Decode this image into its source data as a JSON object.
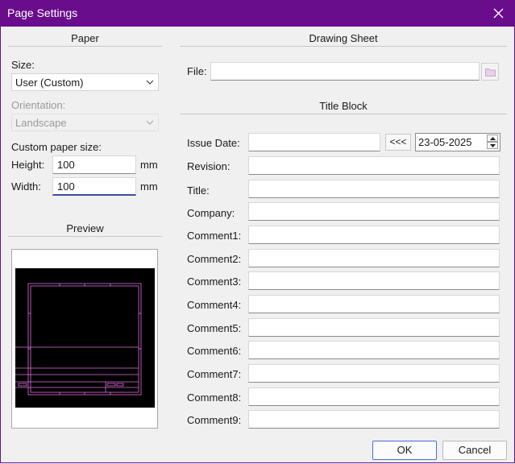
{
  "window": {
    "title": "Page Settings"
  },
  "paper": {
    "section_title": "Paper",
    "size_label": "Size:",
    "size_value": "User (Custom)",
    "orientation_label": "Orientation:",
    "orientation_value": "Landscape",
    "custom_size_label": "Custom paper size:",
    "height_label": "Height:",
    "height_value": "100",
    "height_unit": "mm",
    "width_label": "Width:",
    "width_value": "100",
    "width_unit": "mm"
  },
  "preview": {
    "section_title": "Preview"
  },
  "drawing_sheet": {
    "section_title": "Drawing Sheet",
    "file_label": "File:",
    "file_value": ""
  },
  "title_block": {
    "section_title": "Title Block",
    "issue_date_label": "Issue Date:",
    "issue_date_value": "",
    "copy_date_button": "<<<",
    "date_value": "23-05-2025",
    "fields": [
      {
        "label": "Revision:",
        "value": ""
      },
      {
        "label": "Title:",
        "value": ""
      },
      {
        "label": "Company:",
        "value": ""
      },
      {
        "label": "Comment1:",
        "value": ""
      },
      {
        "label": "Comment2:",
        "value": ""
      },
      {
        "label": "Comment3:",
        "value": ""
      },
      {
        "label": "Comment4:",
        "value": ""
      },
      {
        "label": "Comment5:",
        "value": ""
      },
      {
        "label": "Comment6:",
        "value": ""
      },
      {
        "label": "Comment7:",
        "value": ""
      },
      {
        "label": "Comment8:",
        "value": ""
      },
      {
        "label": "Comment9:",
        "value": ""
      }
    ]
  },
  "buttons": {
    "ok": "OK",
    "cancel": "Cancel"
  },
  "colors": {
    "titlebar": "#6a0d8d",
    "preview_lines": "#e070e0",
    "focus": "#3a4fa0"
  }
}
